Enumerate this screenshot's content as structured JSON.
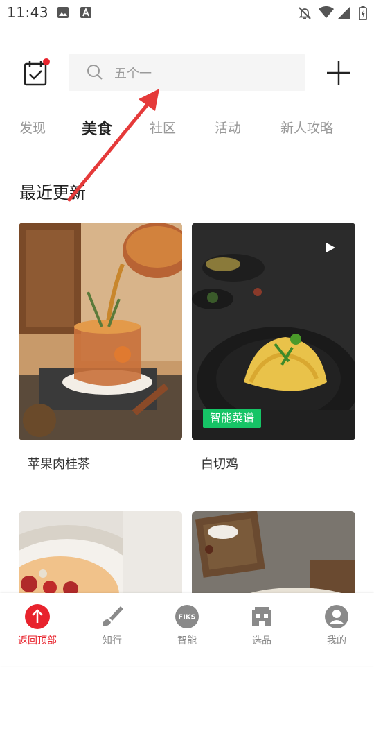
{
  "status": {
    "time": "11:43",
    "icons": [
      "image-icon",
      "font-icon",
      "mute-icon",
      "wifi-icon",
      "signal-icon",
      "battery-icon"
    ]
  },
  "header": {
    "search_placeholder": "五个一",
    "icons": [
      "calendar-icon",
      "search-icon",
      "plus-icon"
    ],
    "accent_color": "#e8232d"
  },
  "tabs": [
    {
      "label": "发现",
      "active": false
    },
    {
      "label": "美食",
      "active": true
    },
    {
      "label": "社区",
      "active": false
    },
    {
      "label": "活动",
      "active": false
    },
    {
      "label": "新人攻略",
      "active": false
    }
  ],
  "section": {
    "title": "最近更新"
  },
  "cards": [
    {
      "title": "苹果肉桂茶",
      "badge": "",
      "video": false
    },
    {
      "title": "白切鸡",
      "badge": "智能菜谱",
      "video": true
    },
    {
      "title": "",
      "badge": "",
      "video": false
    },
    {
      "title": "",
      "badge": "",
      "video": false
    }
  ],
  "bottom_nav": [
    {
      "label": "返回顶部",
      "icon": "arrow-up-icon",
      "active": true
    },
    {
      "label": "知行",
      "icon": "brush-icon",
      "active": false
    },
    {
      "label": "智能",
      "icon": "fiks-icon",
      "active": false
    },
    {
      "label": "选品",
      "icon": "store-icon",
      "active": false
    },
    {
      "label": "我的",
      "icon": "profile-icon",
      "active": false
    }
  ],
  "fiks_text": "FIKS",
  "colors": {
    "accent": "#e8232d",
    "badge_green": "#16c466",
    "search_bg": "#f5f5f5"
  }
}
